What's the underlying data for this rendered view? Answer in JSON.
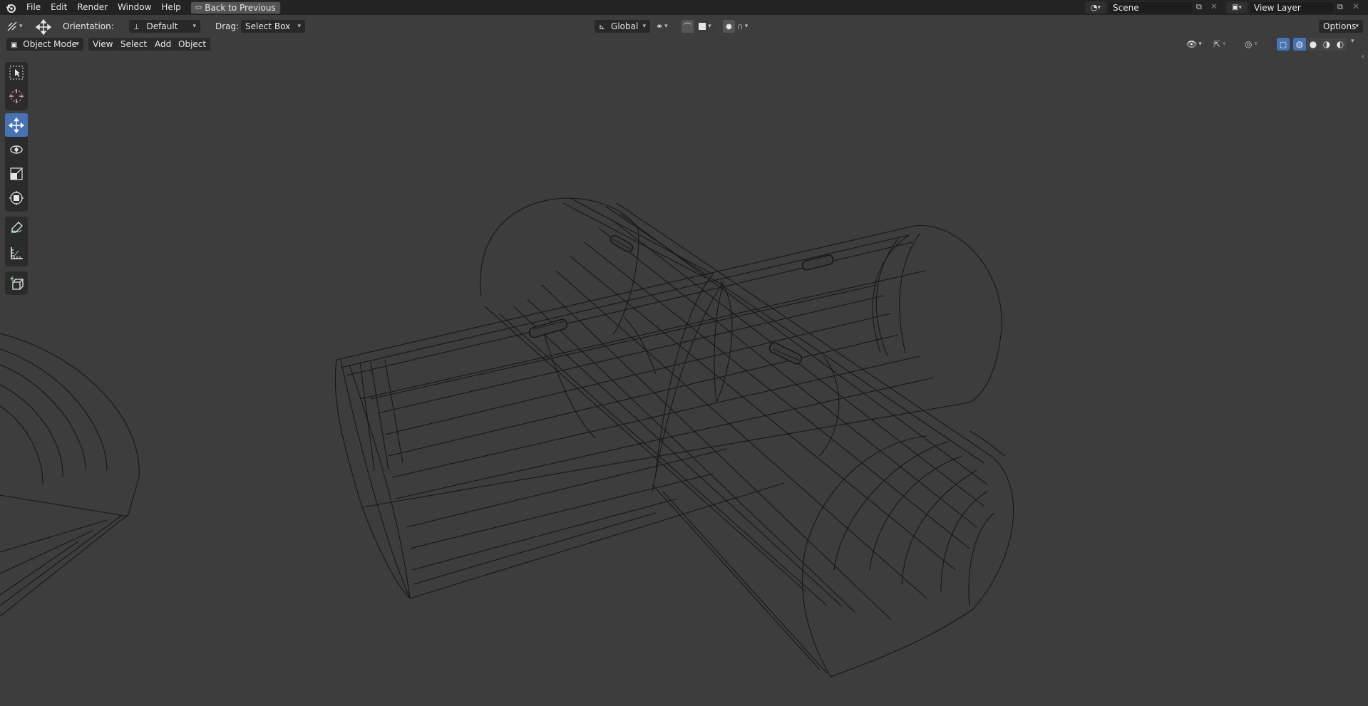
{
  "menu": {
    "file": "File",
    "edit": "Edit",
    "render": "Render",
    "window": "Window",
    "help": "Help",
    "back_to_previous": "Back to Previous"
  },
  "scene": {
    "name": "Scene"
  },
  "view_layer": {
    "name": "View Layer"
  },
  "tool_settings": {
    "orientation_label": "Orientation:",
    "orientation_value": "Default",
    "drag_label": "Drag:",
    "drag_value": "Select Box",
    "transform_orientation": "Global",
    "options_label": "Options"
  },
  "viewport_header": {
    "mode": "Object Mode",
    "view": "View",
    "select": "Select",
    "add": "Add",
    "object": "Object"
  },
  "toolbar": {
    "tools": [
      {
        "icon": "select-box-icon",
        "active": false
      },
      {
        "icon": "cursor-icon",
        "active": false
      },
      {
        "icon": "move-icon",
        "active": true
      },
      {
        "icon": "rotate-icon",
        "active": false
      },
      {
        "icon": "scale-icon",
        "active": false
      },
      {
        "icon": "transform-icon",
        "active": false
      },
      {
        "icon": "annotate-icon",
        "active": false
      },
      {
        "icon": "measure-icon",
        "active": false
      },
      {
        "icon": "add-cube-icon",
        "active": false
      }
    ]
  },
  "colors": {
    "viewport_bg": "#3d3d3d",
    "topbar_bg": "#232323",
    "active_tool": "#4772b3",
    "wire": "#151515"
  }
}
